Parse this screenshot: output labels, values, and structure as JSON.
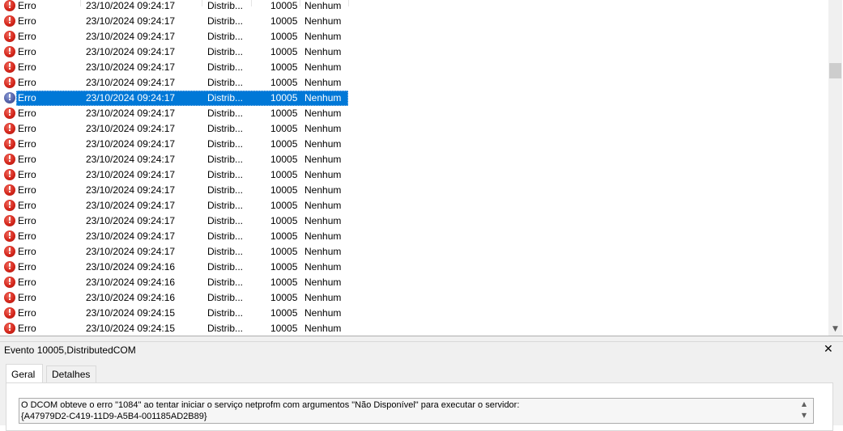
{
  "event_list": {
    "rows": [
      {
        "level": "Erro",
        "date": "23/10/2024 09:24:17",
        "source": "Distrib...",
        "event_id": "10005",
        "category": "Nenhum"
      },
      {
        "level": "Erro",
        "date": "23/10/2024 09:24:17",
        "source": "Distrib...",
        "event_id": "10005",
        "category": "Nenhum"
      },
      {
        "level": "Erro",
        "date": "23/10/2024 09:24:17",
        "source": "Distrib...",
        "event_id": "10005",
        "category": "Nenhum"
      },
      {
        "level": "Erro",
        "date": "23/10/2024 09:24:17",
        "source": "Distrib...",
        "event_id": "10005",
        "category": "Nenhum"
      },
      {
        "level": "Erro",
        "date": "23/10/2024 09:24:17",
        "source": "Distrib...",
        "event_id": "10005",
        "category": "Nenhum"
      },
      {
        "level": "Erro",
        "date": "23/10/2024 09:24:17",
        "source": "Distrib...",
        "event_id": "10005",
        "category": "Nenhum"
      },
      {
        "level": "Erro",
        "date": "23/10/2024 09:24:17",
        "source": "Distrib...",
        "event_id": "10005",
        "category": "Nenhum",
        "selected": true
      },
      {
        "level": "Erro",
        "date": "23/10/2024 09:24:17",
        "source": "Distrib...",
        "event_id": "10005",
        "category": "Nenhum"
      },
      {
        "level": "Erro",
        "date": "23/10/2024 09:24:17",
        "source": "Distrib...",
        "event_id": "10005",
        "category": "Nenhum"
      },
      {
        "level": "Erro",
        "date": "23/10/2024 09:24:17",
        "source": "Distrib...",
        "event_id": "10005",
        "category": "Nenhum"
      },
      {
        "level": "Erro",
        "date": "23/10/2024 09:24:17",
        "source": "Distrib...",
        "event_id": "10005",
        "category": "Nenhum"
      },
      {
        "level": "Erro",
        "date": "23/10/2024 09:24:17",
        "source": "Distrib...",
        "event_id": "10005",
        "category": "Nenhum"
      },
      {
        "level": "Erro",
        "date": "23/10/2024 09:24:17",
        "source": "Distrib...",
        "event_id": "10005",
        "category": "Nenhum"
      },
      {
        "level": "Erro",
        "date": "23/10/2024 09:24:17",
        "source": "Distrib...",
        "event_id": "10005",
        "category": "Nenhum"
      },
      {
        "level": "Erro",
        "date": "23/10/2024 09:24:17",
        "source": "Distrib...",
        "event_id": "10005",
        "category": "Nenhum"
      },
      {
        "level": "Erro",
        "date": "23/10/2024 09:24:17",
        "source": "Distrib...",
        "event_id": "10005",
        "category": "Nenhum"
      },
      {
        "level": "Erro",
        "date": "23/10/2024 09:24:17",
        "source": "Distrib...",
        "event_id": "10005",
        "category": "Nenhum"
      },
      {
        "level": "Erro",
        "date": "23/10/2024 09:24:16",
        "source": "Distrib...",
        "event_id": "10005",
        "category": "Nenhum"
      },
      {
        "level": "Erro",
        "date": "23/10/2024 09:24:16",
        "source": "Distrib...",
        "event_id": "10005",
        "category": "Nenhum"
      },
      {
        "level": "Erro",
        "date": "23/10/2024 09:24:16",
        "source": "Distrib...",
        "event_id": "10005",
        "category": "Nenhum"
      },
      {
        "level": "Erro",
        "date": "23/10/2024 09:24:15",
        "source": "Distrib...",
        "event_id": "10005",
        "category": "Nenhum"
      },
      {
        "level": "Erro",
        "date": "23/10/2024 09:24:15",
        "source": "Distrib...",
        "event_id": "10005",
        "category": "Nenhum"
      }
    ],
    "error_icon": "error-circle-icon",
    "selection_color": "#0078d7"
  },
  "details": {
    "title": "Evento 10005,DistributedCOM",
    "close_label": "✕",
    "tabs": [
      {
        "label": "Geral",
        "active": true
      },
      {
        "label": "Detalhes",
        "active": false
      }
    ],
    "description": "O DCOM obteve o erro \"1084\" ao tentar iniciar o serviço netprofm com argumentos \"Não Disponível\" para executar o servidor:\n{A47979D2-C419-11D9-A5B4-001185AD2B89}"
  }
}
